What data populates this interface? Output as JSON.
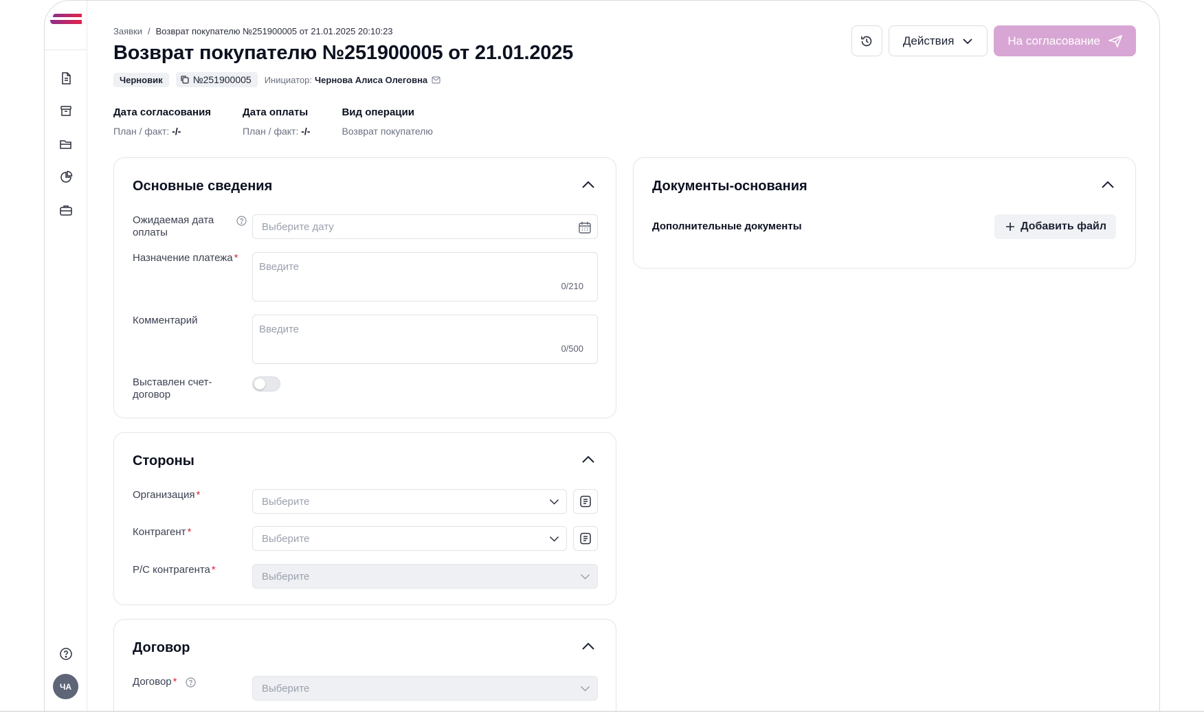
{
  "breadcrumb": {
    "root": "Заявки",
    "separator": "/",
    "current": "Возврат покупателю №251900005 от 21.01.2025 20:10:23"
  },
  "page": {
    "title": "Возврат покупателю №251900005 от 21.01.2025"
  },
  "meta": {
    "status": "Черновик",
    "number": "№251900005",
    "initiator_label": "Инициатор:",
    "initiator_name": "Чернова Алиса Олеговна"
  },
  "header_actions": {
    "actions_label": "Действия",
    "approve_label": "На согласование"
  },
  "stats": [
    {
      "key": "Дата согласования",
      "prefix": "План / факт:",
      "value": "-/-"
    },
    {
      "key": "Дата оплаты",
      "prefix": "План / факт:",
      "value": "-/-"
    },
    {
      "key": "Вид операции",
      "prefix": "Возврат покупателю",
      "value": ""
    }
  ],
  "basic": {
    "title": "Основные сведения",
    "expected_date_label": "Ожидаемая дата оплаты",
    "expected_date_placeholder": "Выберите дату",
    "purpose_label": "Назначение платежа",
    "purpose_placeholder": "Введите",
    "purpose_counter": "0/210",
    "comment_label": "Комментарий",
    "comment_placeholder": "Введите",
    "comment_counter": "0/500",
    "invoice_label": "Выставлен счет-договор"
  },
  "parties": {
    "title": "Стороны",
    "org_label": "Организация",
    "org_placeholder": "Выберите",
    "counterparty_label": "Контрагент",
    "counterparty_placeholder": "Выберите",
    "account_label": "Р/С контрагента",
    "account_placeholder": "Выберите"
  },
  "contract": {
    "title": "Договор",
    "contract_label": "Договор",
    "contract_placeholder": "Выберите"
  },
  "documents": {
    "title": "Документы-основания",
    "extra_label": "Дополнительные документы",
    "add_file_label": "Добавить файл"
  },
  "user": {
    "initials": "ЧА"
  },
  "colors": {
    "accent": "#d8a6d4",
    "required": "#e0243c",
    "logo_top": "#8e2e8a",
    "logo_bottom": "#e2234b"
  }
}
